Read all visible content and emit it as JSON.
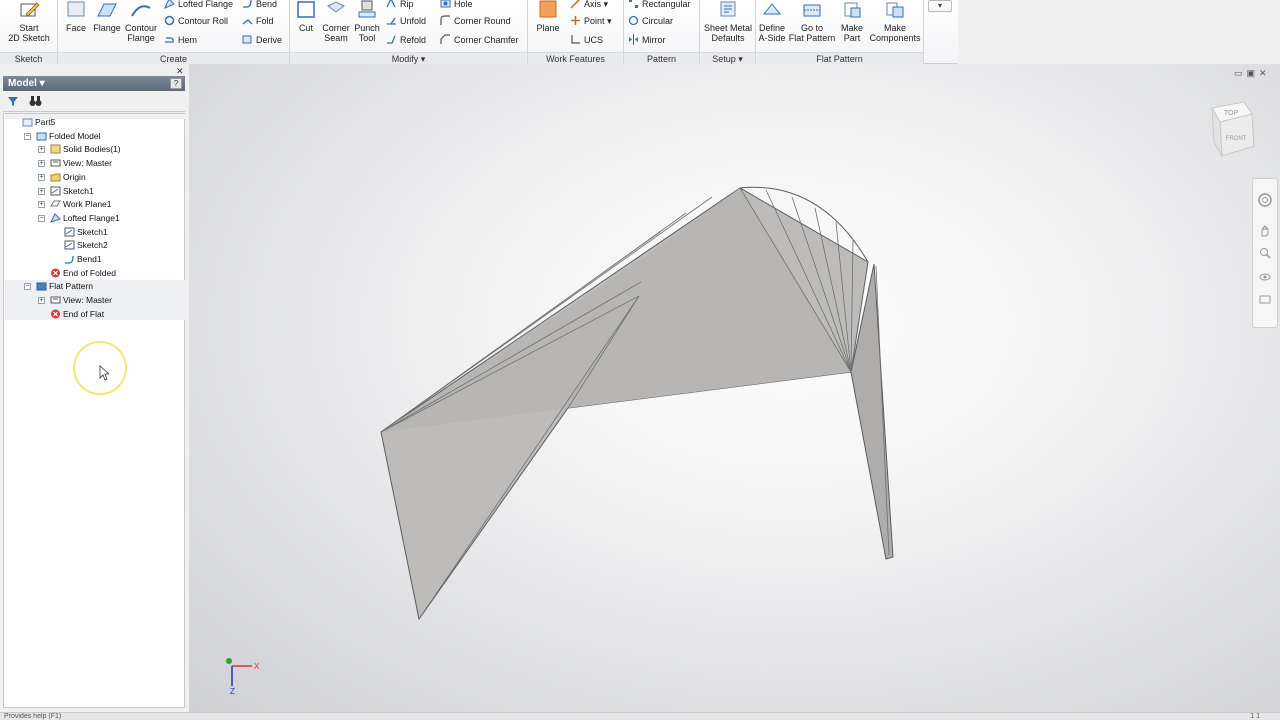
{
  "ribbon": {
    "panels": {
      "sketch": "Sketch",
      "create": "Create",
      "modify": "Modify ▾",
      "work_features": "Work Features",
      "pattern": "Pattern",
      "setup": "Setup ▾",
      "flat_pattern": "Flat Pattern"
    },
    "start_2d_sketch": "Start\n2D Sketch",
    "face": "Face",
    "flange": "Flange",
    "contour_flange": "Contour\nFlange",
    "lofted_flange": "Lofted Flange",
    "contour_roll": "Contour Roll",
    "hem": "Hem",
    "bend": "Bend",
    "fold": "Fold",
    "derive": "Derive",
    "cut": "Cut",
    "corner_seam": "Corner\nSeam",
    "punch_tool": "Punch\nTool",
    "rip": "Rip",
    "unfold": "Unfold",
    "refold": "Refold",
    "hole": "Hole",
    "corner_round": "Corner Round",
    "corner_chamfer": "Corner Chamfer",
    "plane": "Plane",
    "axis": "Axis ▾",
    "point": "Point ▾",
    "ucs": "UCS",
    "rectangular": "Rectangular",
    "circular": "Circular",
    "mirror": "Mirror",
    "sheet_metal_defaults": "Sheet Metal\nDefaults",
    "define_a_side": "Define\nA-Side",
    "go_to_flat_pattern": "Go to\nFlat Pattern",
    "make_part": "Make\nPart",
    "make_components": "Make\nComponents",
    "qa_dropdown": "▾"
  },
  "browser": {
    "title": "Model ▾",
    "help": "?",
    "close": "✕",
    "tree": [
      {
        "label": "Part5",
        "indent": 0,
        "icon": "part-icon"
      },
      {
        "label": "Folded Model",
        "indent": 1,
        "icon": "folded-model-icon"
      },
      {
        "label": "Solid Bodies(1)",
        "indent": 2,
        "icon": "solid-bodies-icon"
      },
      {
        "label": "View: Master",
        "indent": 2,
        "icon": "view-icon"
      },
      {
        "label": "Origin",
        "indent": 2,
        "icon": "folder-icon"
      },
      {
        "label": "Sketch1",
        "indent": 2,
        "icon": "sketch-icon"
      },
      {
        "label": "Work Plane1",
        "indent": 2,
        "icon": "work-plane-icon"
      },
      {
        "label": "Lofted Flange1",
        "indent": 2,
        "icon": "lofted-flange-icon"
      },
      {
        "label": "Sketch1",
        "indent": 3,
        "icon": "sketch-icon"
      },
      {
        "label": "Sketch2",
        "indent": 3,
        "icon": "sketch-icon"
      },
      {
        "label": "Bend1",
        "indent": 3,
        "icon": "bend-icon"
      },
      {
        "label": "End of Folded",
        "indent": 2,
        "icon": "end-of-part-icon"
      },
      {
        "label": "Flat Pattern",
        "indent": 1,
        "icon": "flat-pattern-icon"
      },
      {
        "label": "View: Master",
        "indent": 2,
        "icon": "view-icon"
      },
      {
        "label": "End of Flat",
        "indent": 2,
        "icon": "end-of-part-icon"
      }
    ]
  },
  "viewcube": {
    "top": "TOP",
    "front": "FRONT"
  },
  "triad": {
    "x": "X",
    "y": "Y",
    "z": "Z"
  },
  "colors": {
    "ribbon_icon_blue": "#2f6fc0",
    "sheet_face": "#bdbcba",
    "sheet_edge": "#5c5c5c",
    "end_marker": "#d93a3a",
    "cursor_highlight": "#f2e96b"
  },
  "status": {
    "text": "Provides help (F1)",
    "right": "1    1"
  }
}
